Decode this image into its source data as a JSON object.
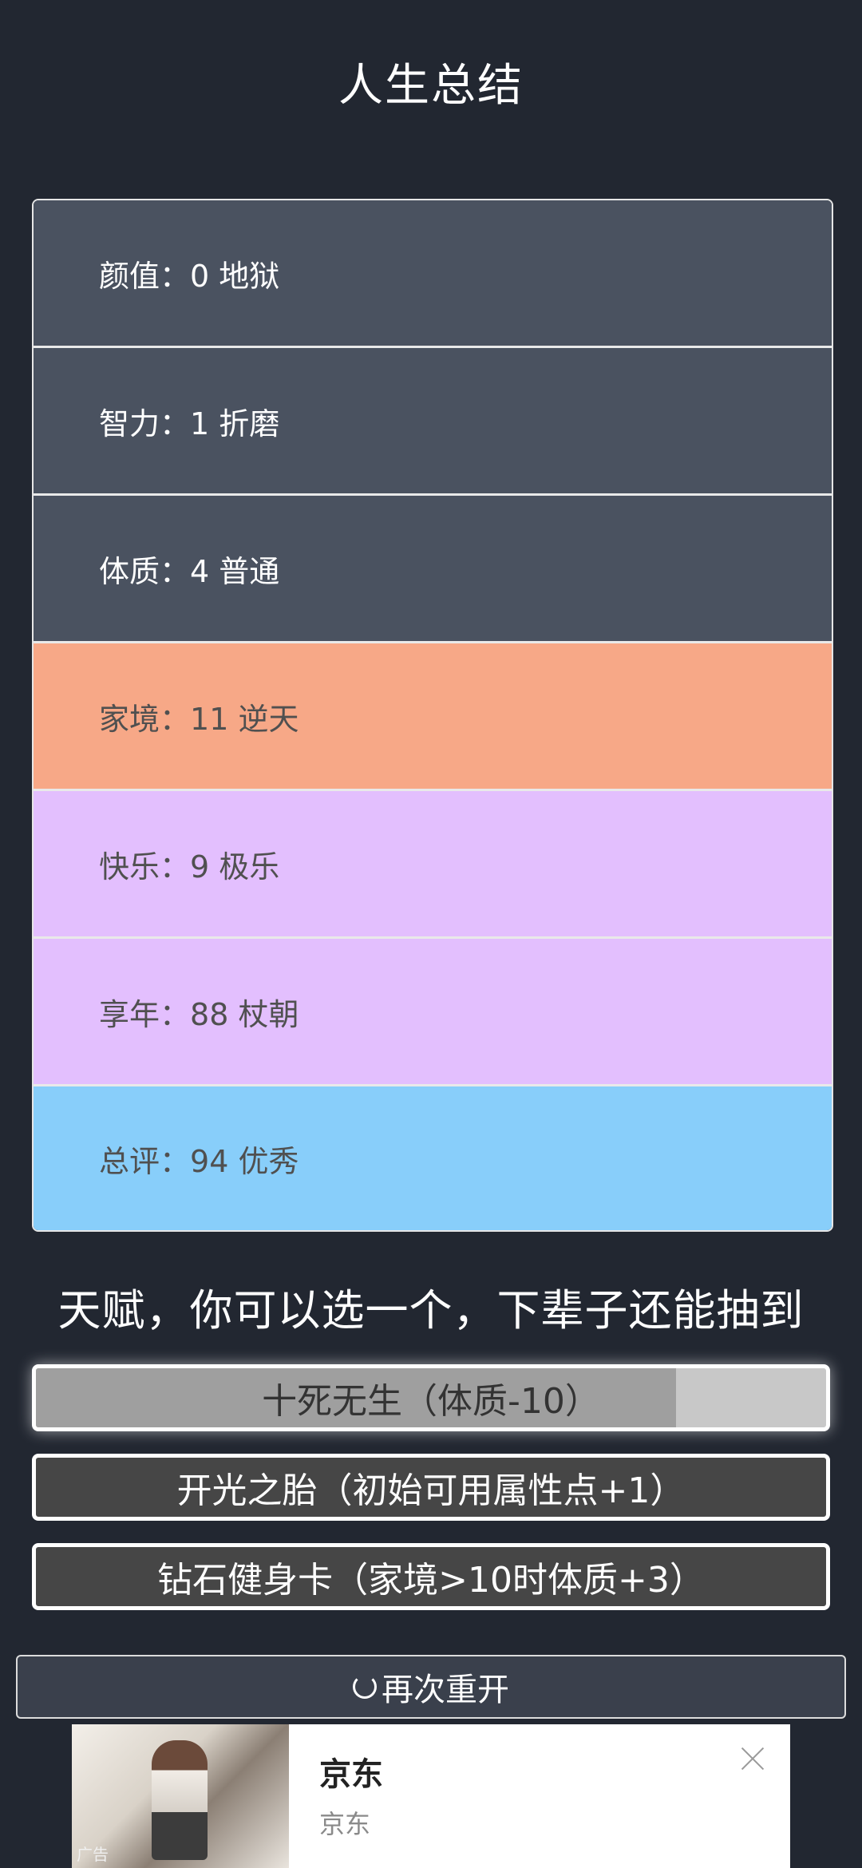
{
  "page": {
    "title": "人生总结"
  },
  "summary": {
    "rows": [
      {
        "label": "颜值：",
        "value": "0 地狱",
        "level": "gray"
      },
      {
        "label": "智力：",
        "value": "1 折磨",
        "level": "gray"
      },
      {
        "label": "体质：",
        "value": "4 普通",
        "level": "gray"
      },
      {
        "label": "家境：",
        "value": "11 逆天",
        "level": "orange"
      },
      {
        "label": "快乐：",
        "value": "9 极乐",
        "level": "purple"
      },
      {
        "label": "享年：",
        "value": "88 杖朝",
        "level": "purple"
      },
      {
        "label": "总评：",
        "value": "94 优秀",
        "level": "blue"
      }
    ]
  },
  "talents": {
    "heading": "天赋，你可以选一个，下辈子还能抽到",
    "items": [
      {
        "label": "十死无生（体质-10）",
        "selected": true,
        "progress": 0.81
      },
      {
        "label": "开光之胎（初始可用属性点+1）",
        "selected": false
      },
      {
        "label": "钻石健身卡（家境>10时体质+3）",
        "selected": false
      }
    ]
  },
  "restart": {
    "label": "再次重开",
    "icon": "refresh-icon"
  },
  "ad": {
    "brand": "京东",
    "subtitle": "京东",
    "tag": "广告",
    "close_icon": "close-icon"
  },
  "colors": {
    "background": "#222731",
    "gray": "#4a5260",
    "orange": "#f7a887",
    "purple": "#e3bffe",
    "blue": "#88cefa"
  }
}
